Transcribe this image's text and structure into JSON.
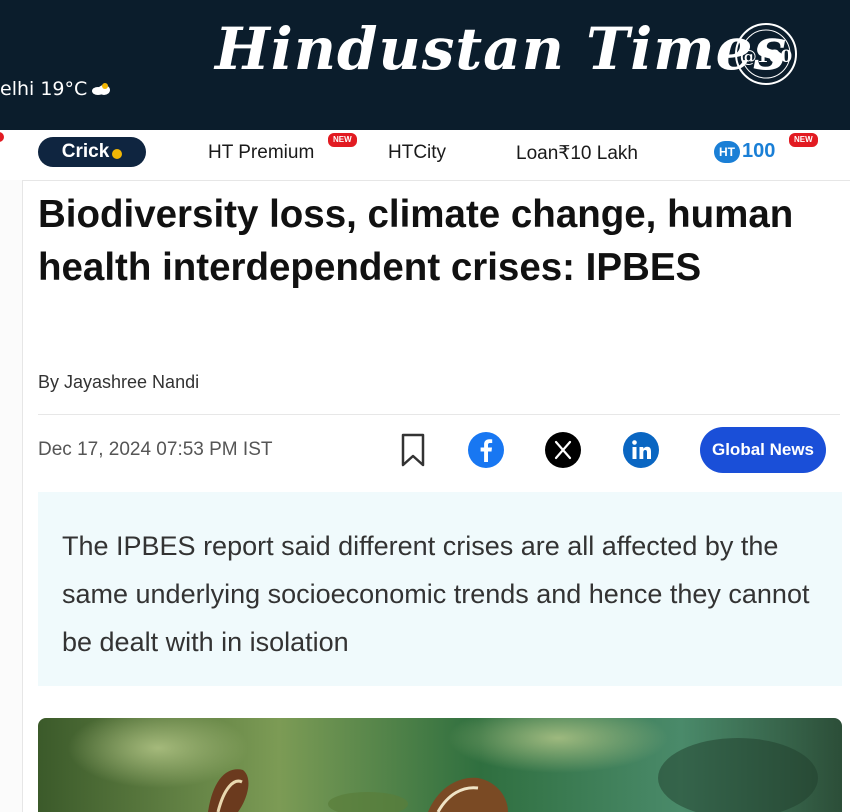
{
  "masthead": {
    "weather": "elhi 19°C",
    "logo_text": "Hindustan Times",
    "badge_text": "@100",
    "bg_color": "#0b1d2c"
  },
  "nav": {
    "cricket_label": "Crick",
    "items": [
      {
        "label": "HT Premium",
        "new_badge": "NEW"
      },
      {
        "label": "HTCity"
      },
      {
        "label": "Loan₹10 Lakh"
      }
    ],
    "ht100_ring": "HT",
    "ht100_label": "100",
    "ht100_badge": "NEW"
  },
  "article": {
    "headline": "Biodiversity loss, climate change, human health interdependent crises: IPBES",
    "byline": "By Jayashree Nandi",
    "date": "Dec 17, 2024 07:53 PM IST",
    "share_icons": [
      "bookmark-icon",
      "facebook-icon",
      "x-icon",
      "linkedin-icon"
    ],
    "global_news_label": "Global News",
    "summary": "The IPBES report said different crises are all affected by the same underlying socioeconomic trends and hence they cannot be dealt with in isolation"
  },
  "colors": {
    "accent_blue": "#1a4fd8",
    "facebook": "#1877f2",
    "linkedin": "#0a66c2",
    "new_badge": "#e21b22",
    "summary_bg": "#f0fafc"
  }
}
